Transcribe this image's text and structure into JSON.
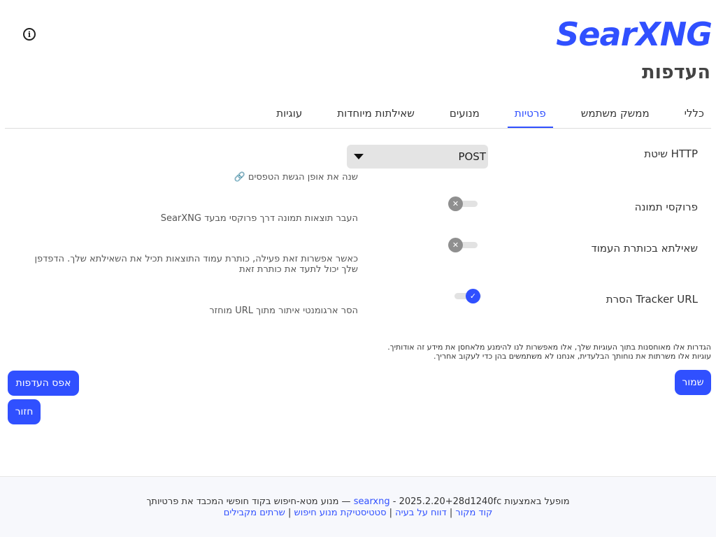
{
  "brand": {
    "logo_text": "SearXNG",
    "accent": "#3050ff"
  },
  "header": {
    "title": "העדפות",
    "info_icon": "info-circle-icon"
  },
  "tabs": [
    {
      "label": "כללי",
      "active": false
    },
    {
      "label": "ממשק משתמש",
      "active": false
    },
    {
      "label": "פרטיות",
      "active": true
    },
    {
      "label": "מנועים",
      "active": false
    },
    {
      "label": "שאילתות מיוחדות",
      "active": false
    },
    {
      "label": "עוגיות",
      "active": false
    }
  ],
  "privacy": {
    "http_method": {
      "label": "שיטת HTTP",
      "value": "POST",
      "description": "שנה את אופן הגשת הטפסים",
      "link_icon": "link-icon"
    },
    "image_proxy": {
      "label": "פרוקסי תמונה",
      "enabled": false,
      "description": "העבר תוצאות תמונה דרך פרוקסי מבעד SearXNG"
    },
    "query_in_title": {
      "label": "שאילתא בכותרת העמוד",
      "enabled": false,
      "description": "כאשר אפשרות זאת פעילה, כותרת עמוד התוצאות תכיל את השאילתא שלך. הדפדפן שלך יכול לתעד את כותרת זאת"
    },
    "tracker_url_remover": {
      "label": "הסרת Tracker URL",
      "enabled": true,
      "description": "הסר ארגומנטי איתור מתוך URL מוחזר"
    }
  },
  "cookie_note": {
    "line1": "הגדרות אלו מאוחסנות בתוך העוגיות שלך, אלו מאפשרות לנו להימנע מלאחסן את מידע זה אודותיך.",
    "line2": "עוגיות אלו משרתות את נוחותך הבלעדית, אנחנו לא משתמשים בהן כדי לעקוב אחריך."
  },
  "buttons": {
    "save": "שמור",
    "reset": "אפס העדפות",
    "back": "חזור"
  },
  "footer": {
    "powered_prefix": "מופעל באמצעות",
    "project_link": "searxng",
    "version": "2025.2.20+28d1240fc",
    "tagline": "— מנוע מטא-חיפוש בקוד חופשי המכבד את פרטיותך",
    "links": [
      "קוד מקור",
      "דווח על בעיה",
      "סטטיסטיקת מנוע חיפוש",
      "שרתים מקבילים"
    ]
  }
}
